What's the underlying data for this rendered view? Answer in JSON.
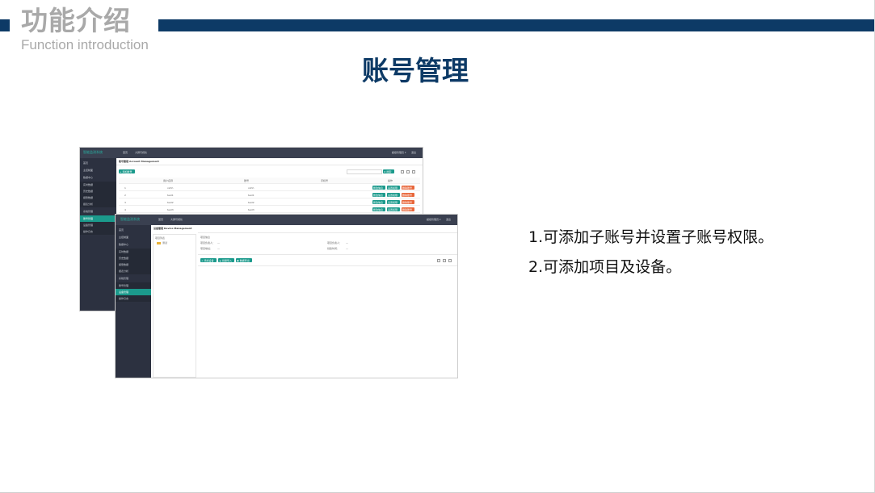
{
  "header": {
    "title_cn": "功能介绍",
    "title_en": "Function introduction"
  },
  "colors": {
    "primary": "#0d3a66",
    "header_gray": "#a9a9a9",
    "accent_teal": "#1b9a8c",
    "accent_orange": "#e8663a",
    "sidebar_dark": "#2c3140"
  },
  "slide_title": "账号管理",
  "description": [
    "1.可添加子账号并设置子账号权限。",
    "2.可添加项目及设备。"
  ],
  "screenshot1": {
    "logo": "智能监测系统",
    "top_tabs": [
      "首页",
      "大屏可视化"
    ],
    "user_menu": "超级管理员 ▾",
    "logout": "退出",
    "sidebar": [
      "首页",
      "主控制面",
      "数据中心",
      "实时数据",
      "历史数据",
      "报警数据",
      "报表分析",
      "系统管理",
      "账号管理",
      "设备管理",
      "操作日志"
    ],
    "breadcrumb": "账号管理 Account Management",
    "add_button": "+ 添加账号",
    "search_button": "Q 搜索",
    "table_headers": [
      "用户名称",
      "账号",
      "手机号",
      "操作"
    ],
    "rows": [
      {
        "id": "1",
        "name": "xxhh",
        "account": "xxhh"
      },
      {
        "id": "2",
        "name": "test1",
        "account": "test1"
      },
      {
        "id": "3",
        "name": "test2",
        "account": "test2"
      },
      {
        "id": "4",
        "name": "test3",
        "account": "test3"
      }
    ],
    "row_actions": [
      "修改信息",
      "设置权限",
      "删除账号"
    ]
  },
  "screenshot2": {
    "logo": "智能监测系统",
    "top_tabs": [
      "首页",
      "大屏可视化"
    ],
    "user_menu": "超级管理员 ▾",
    "logout": "退出",
    "sidebar": [
      "首页",
      "主控制面",
      "数据中心",
      "实时数据",
      "历史数据",
      "报警数据",
      "报表分析",
      "系统管理",
      "账号管理",
      "设备管理",
      "操作日志"
    ],
    "breadcrumb": "设备管理 Device Management",
    "tree_title": "项目列表",
    "tree_root": "测试",
    "info_title": "项目信息",
    "info_fields": [
      "项目负责人：",
      "项目地址：",
      "项目负责人：",
      "创建时间："
    ],
    "info_values": [
      "—",
      "—",
      "—",
      "—"
    ],
    "buttons": [
      "+ 添加设备",
      "☁ 批量导入",
      "▣ 数据导出"
    ]
  }
}
